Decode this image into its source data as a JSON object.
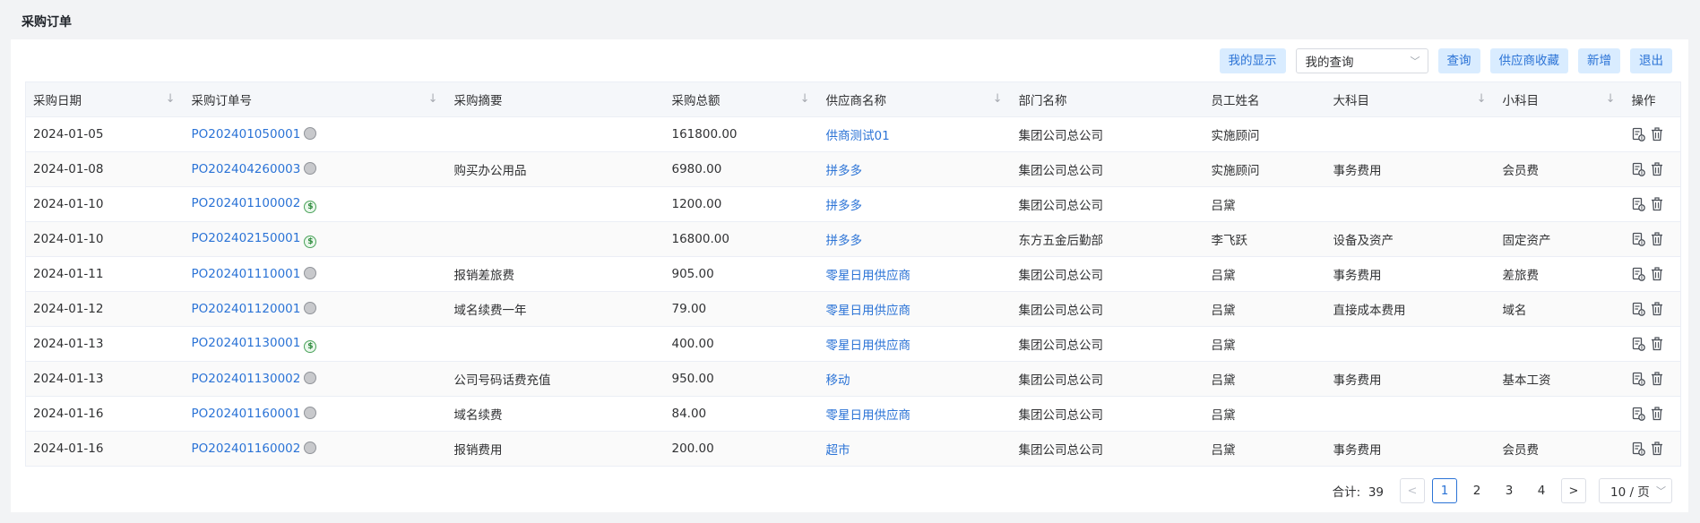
{
  "page": {
    "title": "采购订单"
  },
  "toolbar": {
    "my_display": "我的显示",
    "query_select": "我的查询",
    "query": "查询",
    "supplier_favorites": "供应商收藏",
    "add": "新增",
    "exit": "退出"
  },
  "table": {
    "headers": {
      "date": "采购日期",
      "order_no": "采购订单号",
      "summary": "采购摘要",
      "amount": "采购总额",
      "supplier": "供应商名称",
      "department": "部门名称",
      "employee": "员工姓名",
      "major": "大科目",
      "minor": "小科目",
      "ops": "操作"
    },
    "rows": [
      {
        "date": "2024-01-05",
        "order_no": "PO202401050001",
        "status": "gray",
        "summary": "",
        "amount": "161800.00",
        "supplier": "供商测试01",
        "department": "集团公司总公司",
        "employee": "实施顾问",
        "major": "",
        "minor": ""
      },
      {
        "date": "2024-01-08",
        "order_no": "PO202404260003",
        "status": "gray",
        "summary": "购买办公用品",
        "amount": "6980.00",
        "supplier": "拼多多",
        "department": "集团公司总公司",
        "employee": "实施顾问",
        "major": "事务费用",
        "minor": "会员费"
      },
      {
        "date": "2024-01-10",
        "order_no": "PO202401100002",
        "status": "green",
        "summary": "",
        "amount": "1200.00",
        "supplier": "拼多多",
        "department": "集团公司总公司",
        "employee": "吕黛",
        "major": "",
        "minor": ""
      },
      {
        "date": "2024-01-10",
        "order_no": "PO202402150001",
        "status": "green",
        "summary": "",
        "amount": "16800.00",
        "supplier": "拼多多",
        "department": "东方五金后勤部",
        "employee": "李飞跃",
        "major": "设备及资产",
        "minor": "固定资产"
      },
      {
        "date": "2024-01-11",
        "order_no": "PO202401110001",
        "status": "gray",
        "summary": "报销差旅费",
        "amount": "905.00",
        "supplier": "零星日用供应商",
        "department": "集团公司总公司",
        "employee": "吕黛",
        "major": "事务费用",
        "minor": "差旅费"
      },
      {
        "date": "2024-01-12",
        "order_no": "PO202401120001",
        "status": "gray",
        "summary": "域名续费一年",
        "amount": "79.00",
        "supplier": "零星日用供应商",
        "department": "集团公司总公司",
        "employee": "吕黛",
        "major": "直接成本费用",
        "minor": "域名"
      },
      {
        "date": "2024-01-13",
        "order_no": "PO202401130001",
        "status": "green",
        "summary": "",
        "amount": "400.00",
        "supplier": "零星日用供应商",
        "department": "集团公司总公司",
        "employee": "吕黛",
        "major": "",
        "minor": ""
      },
      {
        "date": "2024-01-13",
        "order_no": "PO202401130002",
        "status": "gray",
        "summary": "公司号码话费充值",
        "amount": "950.00",
        "supplier": "移动",
        "department": "集团公司总公司",
        "employee": "吕黛",
        "major": "事务费用",
        "minor": "基本工资"
      },
      {
        "date": "2024-01-16",
        "order_no": "PO202401160001",
        "status": "gray",
        "summary": "域名续费",
        "amount": "84.00",
        "supplier": "零星日用供应商",
        "department": "集团公司总公司",
        "employee": "吕黛",
        "major": "",
        "minor": ""
      },
      {
        "date": "2024-01-16",
        "order_no": "PO202401160002",
        "status": "gray",
        "summary": "报销费用",
        "amount": "200.00",
        "supplier": "超市",
        "department": "集团公司总公司",
        "employee": "吕黛",
        "major": "事务费用",
        "minor": "会员费"
      }
    ]
  },
  "pagination": {
    "total_label": "合计:",
    "total": "39",
    "prev": "<",
    "next": ">",
    "pages": [
      "1",
      "2",
      "3",
      "4"
    ],
    "current": "1",
    "page_size": "10 / 页"
  },
  "icons": {
    "sort": "sort-down-arrow",
    "edit": "document-edit-icon",
    "delete": "trash-icon",
    "status_gray": "gray-circle",
    "status_green": "dollar-circle"
  },
  "colors": {
    "accent": "#2b73d6",
    "button_bg": "#d9ecff",
    "status_green": "#4aa35a",
    "status_gray": "#c8c9cc"
  }
}
